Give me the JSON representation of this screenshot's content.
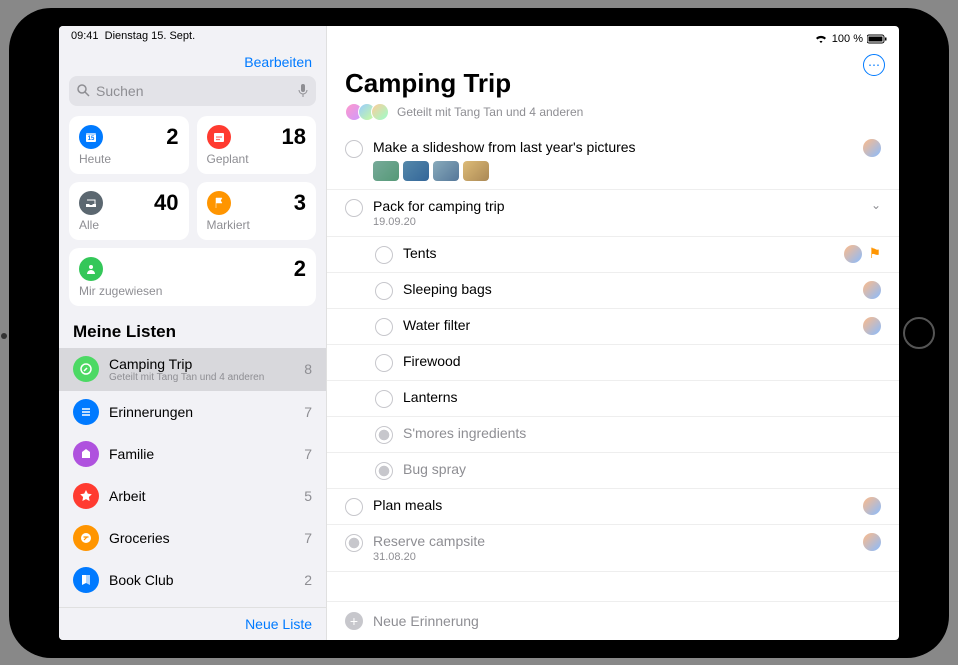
{
  "status": {
    "time": "09:41",
    "date": "Dienstag 15. Sept.",
    "battery": "100 %"
  },
  "sidebar": {
    "edit": "Bearbeiten",
    "search_placeholder": "Suchen",
    "cards": {
      "today": {
        "label": "Heute",
        "count": "2",
        "color": "#007aff"
      },
      "scheduled": {
        "label": "Geplant",
        "count": "18",
        "color": "#ff3b30"
      },
      "all": {
        "label": "Alle",
        "count": "40",
        "color": "#5b6770"
      },
      "flagged": {
        "label": "Markiert",
        "count": "3",
        "color": "#ff9500"
      },
      "assigned": {
        "label": "Mir zugewiesen",
        "count": "2",
        "color": "#34c759"
      }
    },
    "section": "Meine Listen",
    "lists": [
      {
        "name": "Camping Trip",
        "sub": "Geteilt mit Tang Tan und 4 anderen",
        "count": "8",
        "color": "#4cd964",
        "selected": true
      },
      {
        "name": "Erinnerungen",
        "count": "7",
        "color": "#007aff"
      },
      {
        "name": "Familie",
        "count": "7",
        "color": "#af52de"
      },
      {
        "name": "Arbeit",
        "count": "5",
        "color": "#ff3b30"
      },
      {
        "name": "Groceries",
        "count": "7",
        "color": "#ff9500"
      },
      {
        "name": "Book Club",
        "count": "2",
        "color": "#007aff"
      }
    ],
    "new_list": "Neue Liste"
  },
  "main": {
    "title": "Camping Trip",
    "shared": "Geteilt mit Tang Tan und 4 anderen",
    "tasks": [
      {
        "text": "Make a slideshow from last year's pictures",
        "assignee": true,
        "thumbs": true
      },
      {
        "text": "Pack for camping trip",
        "date": "19.09.20",
        "expandable": true
      },
      {
        "text": "Tents",
        "sub": true,
        "assignee": true,
        "flag": true
      },
      {
        "text": "Sleeping bags",
        "sub": true,
        "assignee": true
      },
      {
        "text": "Water filter",
        "sub": true,
        "assignee": true
      },
      {
        "text": "Firewood",
        "sub": true
      },
      {
        "text": "Lanterns",
        "sub": true
      },
      {
        "text": "S'mores ingredients",
        "sub": true,
        "done": true
      },
      {
        "text": "Bug spray",
        "sub": true,
        "done": true
      },
      {
        "text": "Plan meals",
        "assignee": true
      },
      {
        "text": "Reserve campsite",
        "date": "31.08.20",
        "done": true,
        "assignee": true
      }
    ],
    "new_reminder": "Neue Erinnerung"
  }
}
